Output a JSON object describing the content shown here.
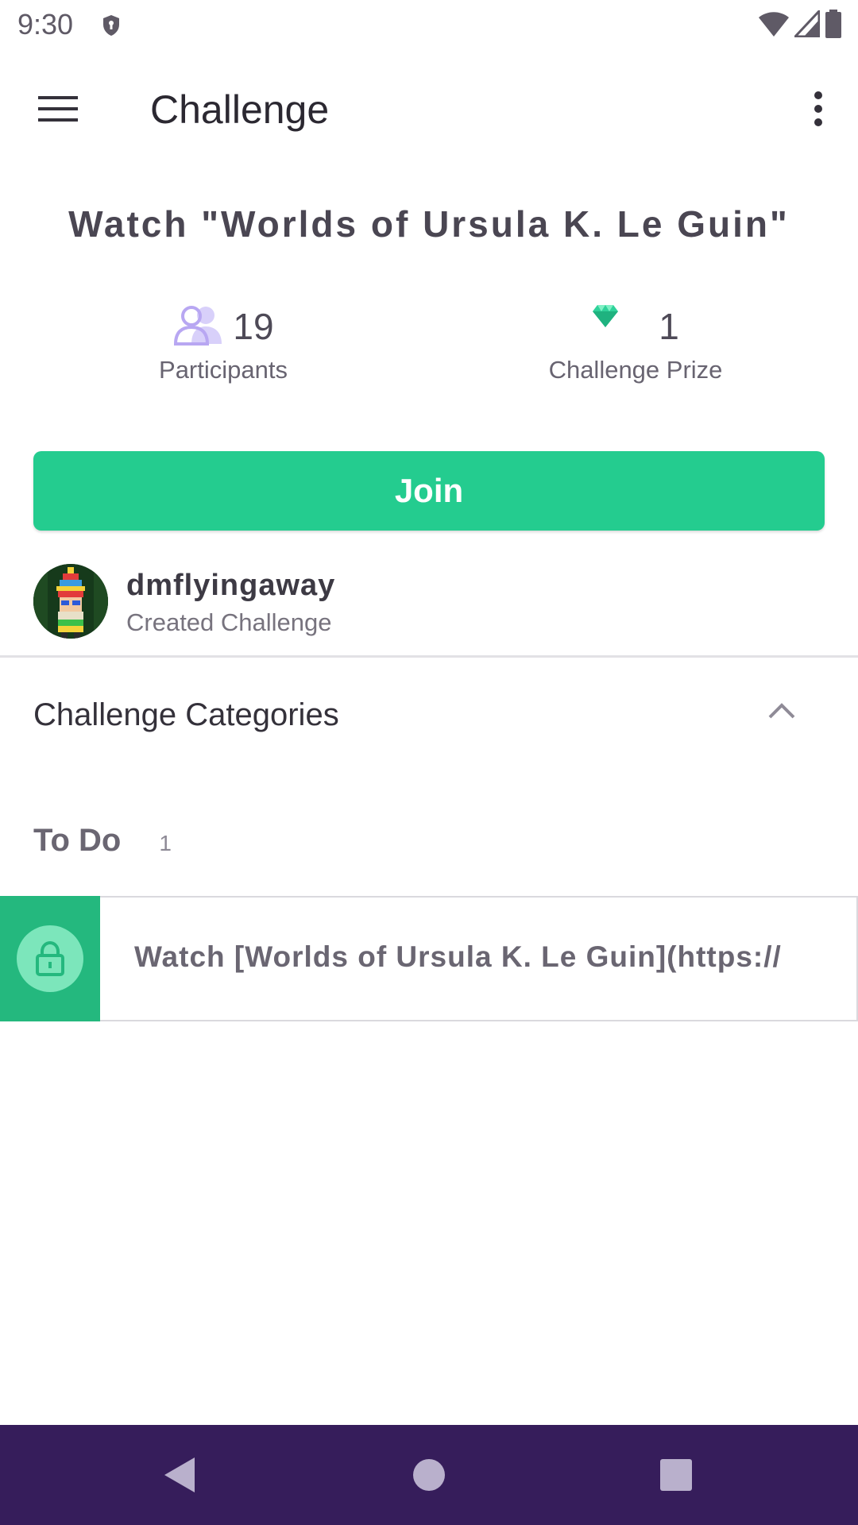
{
  "status_bar": {
    "time": "9:30",
    "icons": [
      "shield-icon",
      "wifi-icon",
      "signal-icon",
      "battery-icon"
    ]
  },
  "app_bar": {
    "title": "Challenge",
    "menu_icon": "hamburger-menu-icon",
    "overflow_icon": "more-vert-icon"
  },
  "challenge": {
    "title": "Watch \"Worlds of Ursula K. Le Guin\"",
    "participants": {
      "value": "19",
      "label": "Participants",
      "icon": "people-icon"
    },
    "prize": {
      "value": "1",
      "label": "Challenge Prize",
      "icon": "gem-icon"
    },
    "join_label": "Join"
  },
  "creator": {
    "name": "dmflyingaway",
    "subtitle": "Created Challenge"
  },
  "categories": {
    "label": "Challenge Categories",
    "expanded": true
  },
  "todo": {
    "title": "To Do",
    "count": "1",
    "items": [
      {
        "text": "Watch [Worlds of Ursula K. Le Guin](https://",
        "locked": true
      }
    ]
  },
  "nav": [
    "back-icon",
    "home-icon",
    "recents-icon"
  ],
  "colors": {
    "accent_green": "#24cc8f",
    "lock_green": "#24b87e",
    "nav_bar": "#361d5b",
    "participants_purple": "#b8a7f2",
    "gem_green": "#2fd29a"
  }
}
